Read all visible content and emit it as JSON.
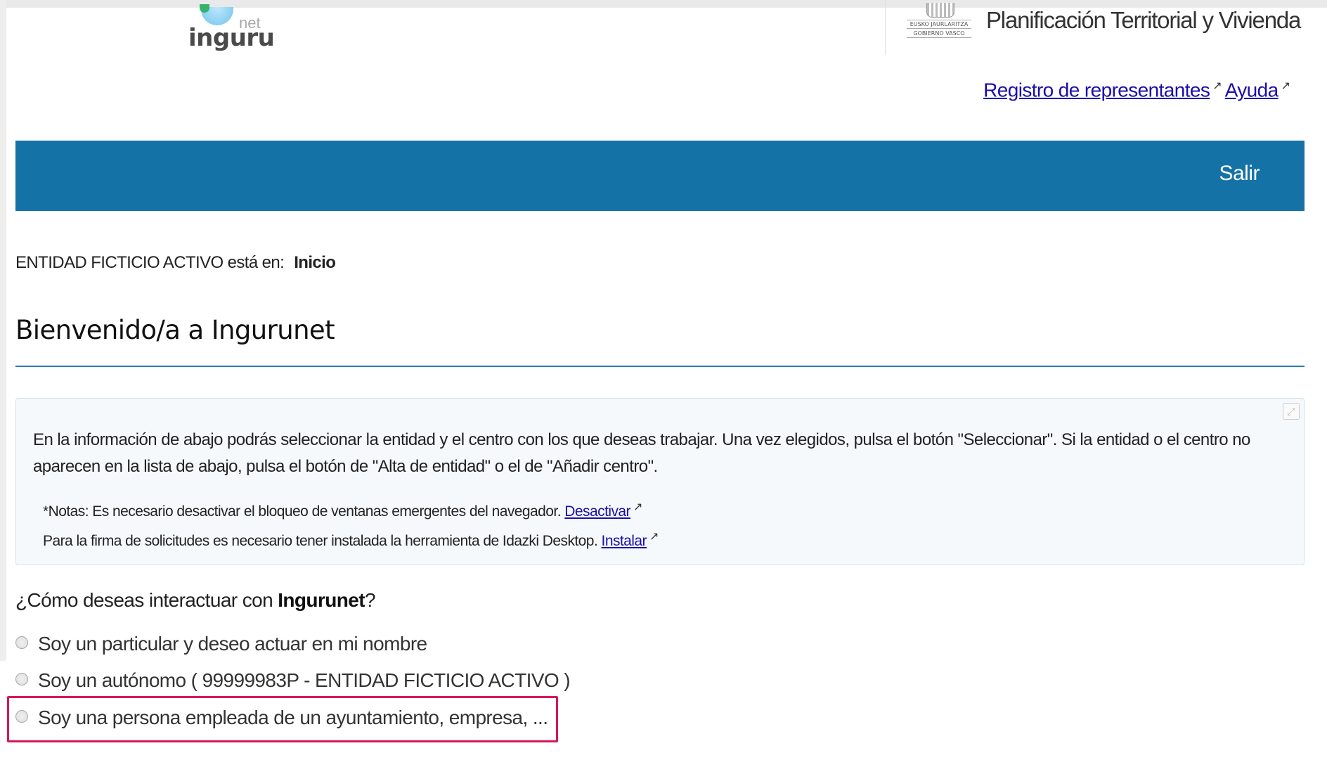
{
  "logo": {
    "net": "net",
    "word": "inguru"
  },
  "gov": {
    "crest_line1": "EUSKO JAURLARITZA",
    "crest_line2": "GOBIERNO VASCO",
    "department": "Planificación Territorial y Vivienda"
  },
  "top_links": {
    "registro": "Registro de representantes",
    "ayuda": "Ayuda"
  },
  "navbar": {
    "salir": "Salir"
  },
  "breadcrumb": {
    "prefix": "ENTIDAD FICTICIO ACTIVO está en:",
    "current": "Inicio"
  },
  "page": {
    "title": "Bienvenido/a a Ingurunet"
  },
  "info": {
    "paragraph": "En la información de abajo podrás seleccionar la entidad y el centro con los que deseas trabajar. Una vez elegidos, pulsa el botón \"Seleccionar\". Si la entidad o el centro no aparecen en la lista de abajo, pulsa el botón de \"Alta de entidad\" o el de \"Añadir centro\".",
    "note1_text": "*Notas: Es necesario desactivar el bloqueo de ventanas emergentes del navegador.",
    "note1_link": "Desactivar",
    "note2_text": "Para la firma de solicitudes es necesario tener instalada la herramienta de Idazki Desktop.",
    "note2_link": "Instalar"
  },
  "question": {
    "prefix": "¿Cómo deseas interactuar con",
    "bold": "Ingurunet",
    "suffix": "?"
  },
  "options": [
    "Soy un particular y deseo actuar en mi nombre",
    "Soy un autónomo ( 99999983P - ENTIDAD FICTICIO ACTIVO )",
    "Soy una persona empleada de un ayuntamiento, empresa, ..."
  ],
  "icons": {
    "external": "external-link-icon",
    "expand": "expand-icon"
  },
  "colors": {
    "navbar": "#1572a6",
    "link": "#1a0dab",
    "highlight": "#d6175a"
  }
}
